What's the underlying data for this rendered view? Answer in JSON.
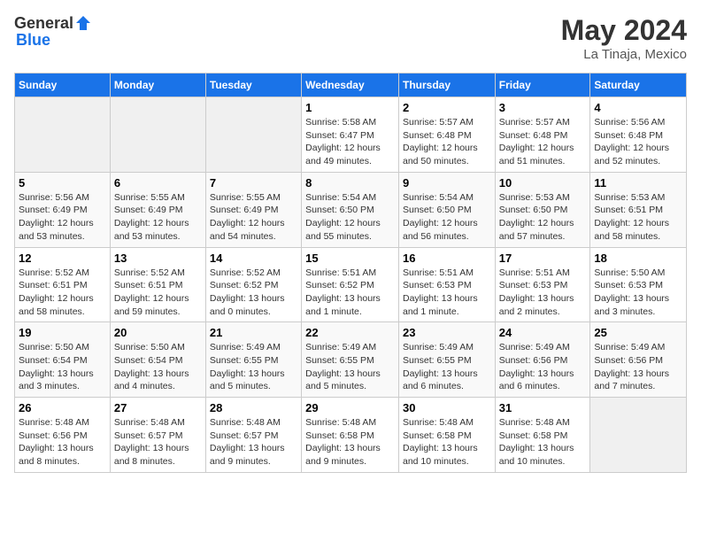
{
  "header": {
    "logo_general": "General",
    "logo_blue": "Blue",
    "month": "May 2024",
    "location": "La Tinaja, Mexico"
  },
  "weekdays": [
    "Sunday",
    "Monday",
    "Tuesday",
    "Wednesday",
    "Thursday",
    "Friday",
    "Saturday"
  ],
  "weeks": [
    [
      {
        "day": "",
        "info": ""
      },
      {
        "day": "",
        "info": ""
      },
      {
        "day": "",
        "info": ""
      },
      {
        "day": "1",
        "info": "Sunrise: 5:58 AM\nSunset: 6:47 PM\nDaylight: 12 hours and 49 minutes."
      },
      {
        "day": "2",
        "info": "Sunrise: 5:57 AM\nSunset: 6:48 PM\nDaylight: 12 hours and 50 minutes."
      },
      {
        "day": "3",
        "info": "Sunrise: 5:57 AM\nSunset: 6:48 PM\nDaylight: 12 hours and 51 minutes."
      },
      {
        "day": "4",
        "info": "Sunrise: 5:56 AM\nSunset: 6:48 PM\nDaylight: 12 hours and 52 minutes."
      }
    ],
    [
      {
        "day": "5",
        "info": "Sunrise: 5:56 AM\nSunset: 6:49 PM\nDaylight: 12 hours and 53 minutes."
      },
      {
        "day": "6",
        "info": "Sunrise: 5:55 AM\nSunset: 6:49 PM\nDaylight: 12 hours and 53 minutes."
      },
      {
        "day": "7",
        "info": "Sunrise: 5:55 AM\nSunset: 6:49 PM\nDaylight: 12 hours and 54 minutes."
      },
      {
        "day": "8",
        "info": "Sunrise: 5:54 AM\nSunset: 6:50 PM\nDaylight: 12 hours and 55 minutes."
      },
      {
        "day": "9",
        "info": "Sunrise: 5:54 AM\nSunset: 6:50 PM\nDaylight: 12 hours and 56 minutes."
      },
      {
        "day": "10",
        "info": "Sunrise: 5:53 AM\nSunset: 6:50 PM\nDaylight: 12 hours and 57 minutes."
      },
      {
        "day": "11",
        "info": "Sunrise: 5:53 AM\nSunset: 6:51 PM\nDaylight: 12 hours and 58 minutes."
      }
    ],
    [
      {
        "day": "12",
        "info": "Sunrise: 5:52 AM\nSunset: 6:51 PM\nDaylight: 12 hours and 58 minutes."
      },
      {
        "day": "13",
        "info": "Sunrise: 5:52 AM\nSunset: 6:51 PM\nDaylight: 12 hours and 59 minutes."
      },
      {
        "day": "14",
        "info": "Sunrise: 5:52 AM\nSunset: 6:52 PM\nDaylight: 13 hours and 0 minutes."
      },
      {
        "day": "15",
        "info": "Sunrise: 5:51 AM\nSunset: 6:52 PM\nDaylight: 13 hours and 1 minute."
      },
      {
        "day": "16",
        "info": "Sunrise: 5:51 AM\nSunset: 6:53 PM\nDaylight: 13 hours and 1 minute."
      },
      {
        "day": "17",
        "info": "Sunrise: 5:51 AM\nSunset: 6:53 PM\nDaylight: 13 hours and 2 minutes."
      },
      {
        "day": "18",
        "info": "Sunrise: 5:50 AM\nSunset: 6:53 PM\nDaylight: 13 hours and 3 minutes."
      }
    ],
    [
      {
        "day": "19",
        "info": "Sunrise: 5:50 AM\nSunset: 6:54 PM\nDaylight: 13 hours and 3 minutes."
      },
      {
        "day": "20",
        "info": "Sunrise: 5:50 AM\nSunset: 6:54 PM\nDaylight: 13 hours and 4 minutes."
      },
      {
        "day": "21",
        "info": "Sunrise: 5:49 AM\nSunset: 6:55 PM\nDaylight: 13 hours and 5 minutes."
      },
      {
        "day": "22",
        "info": "Sunrise: 5:49 AM\nSunset: 6:55 PM\nDaylight: 13 hours and 5 minutes."
      },
      {
        "day": "23",
        "info": "Sunrise: 5:49 AM\nSunset: 6:55 PM\nDaylight: 13 hours and 6 minutes."
      },
      {
        "day": "24",
        "info": "Sunrise: 5:49 AM\nSunset: 6:56 PM\nDaylight: 13 hours and 6 minutes."
      },
      {
        "day": "25",
        "info": "Sunrise: 5:49 AM\nSunset: 6:56 PM\nDaylight: 13 hours and 7 minutes."
      }
    ],
    [
      {
        "day": "26",
        "info": "Sunrise: 5:48 AM\nSunset: 6:56 PM\nDaylight: 13 hours and 8 minutes."
      },
      {
        "day": "27",
        "info": "Sunrise: 5:48 AM\nSunset: 6:57 PM\nDaylight: 13 hours and 8 minutes."
      },
      {
        "day": "28",
        "info": "Sunrise: 5:48 AM\nSunset: 6:57 PM\nDaylight: 13 hours and 9 minutes."
      },
      {
        "day": "29",
        "info": "Sunrise: 5:48 AM\nSunset: 6:58 PM\nDaylight: 13 hours and 9 minutes."
      },
      {
        "day": "30",
        "info": "Sunrise: 5:48 AM\nSunset: 6:58 PM\nDaylight: 13 hours and 10 minutes."
      },
      {
        "day": "31",
        "info": "Sunrise: 5:48 AM\nSunset: 6:58 PM\nDaylight: 13 hours and 10 minutes."
      },
      {
        "day": "",
        "info": ""
      }
    ]
  ]
}
